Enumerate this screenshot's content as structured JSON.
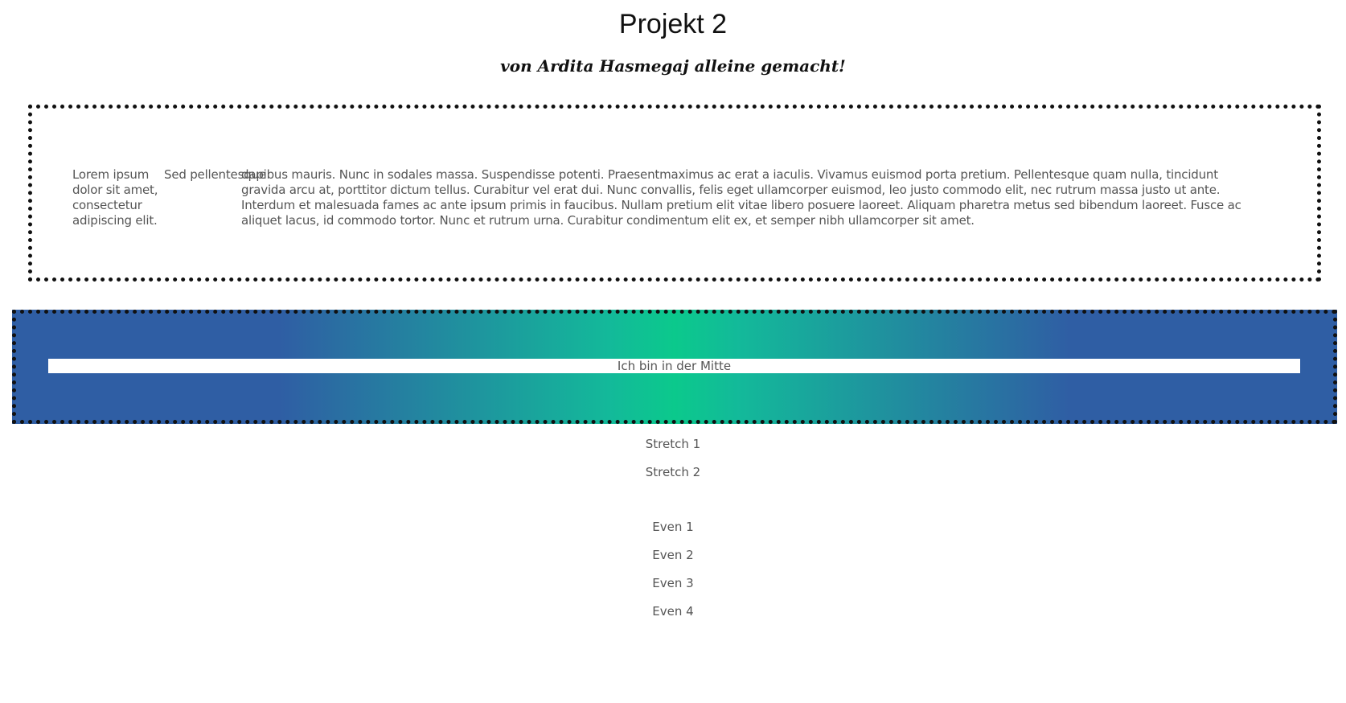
{
  "header": {
    "title": "Projekt 2",
    "subtitle": "von Ardita Hasmegaj alleine gemacht!"
  },
  "text_section": {
    "columns": [
      "Lorem ipsum dolor sit amet, consectetur adipiscing elit.",
      "Sed pellentesque",
      "dapibus mauris. Nunc in sodales massa. Suspendisse potenti. Praesentmaximus ac erat a iaculis. Vivamus euismod porta pretium. Pellentesque quam nulla, tincidunt gravida arcu at, porttitor dictum tellus. Curabitur vel erat dui. Nunc convallis, felis eget ullamcorper euismod, leo justo commodo elit, nec rutrum massa justo ut ante. Interdum et malesuada fames ac ante ipsum primis in faucibus. Nullam pretium elit vitae libero posuere laoreet. Aliquam pharetra metus sed bibendum laoreet. Fusce ac aliquet lacus, id commodo tortor. Nunc et rutrum urna. Curabitur condimentum elit ex, et semper nibh ullamcorper sit amet."
    ]
  },
  "gradient_section": {
    "center_text": "Ich bin in der Mitte",
    "colors": {
      "edge": "#2f5ea4",
      "center": "#0bc98c"
    }
  },
  "stretch_items": [
    "Stretch 1",
    "Stretch 2"
  ],
  "even_items": [
    "Even 1",
    "Even 2",
    "Even 3",
    "Even 4"
  ]
}
